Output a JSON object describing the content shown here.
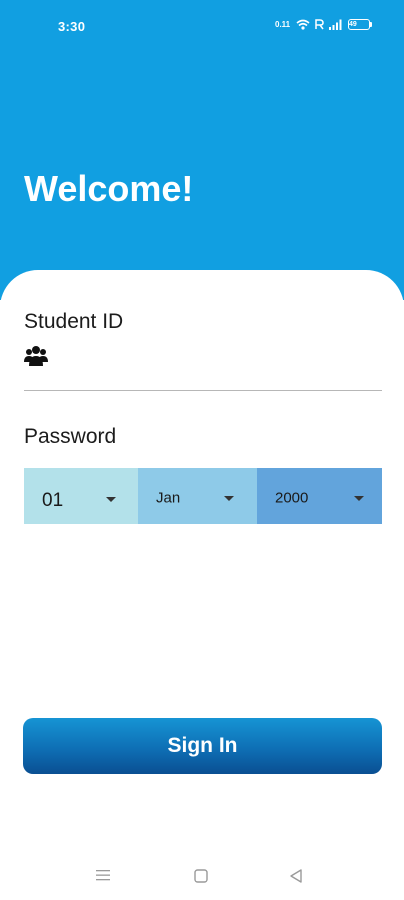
{
  "status_bar": {
    "time": "3:30",
    "network_speed": "0.11",
    "battery": "49"
  },
  "header": {
    "title": "Welcome!"
  },
  "form": {
    "student_id_label": "Student ID",
    "student_id_icon": "users-icon",
    "password_label": "Password",
    "day_value": "01",
    "month_value": "Jan",
    "year_value": "2000",
    "sign_in_label": "Sign In"
  },
  "colors": {
    "header_bg": "#119fe1",
    "day_bg": "#b3e1ea",
    "month_bg": "#8ecae8",
    "year_bg": "#62a4dc",
    "button_top": "#1694d4",
    "button_bottom": "#0a4f92"
  },
  "nav": {
    "menu_icon": "menu-icon",
    "home_icon": "square-home-icon",
    "back_icon": "back-triangle-icon"
  }
}
